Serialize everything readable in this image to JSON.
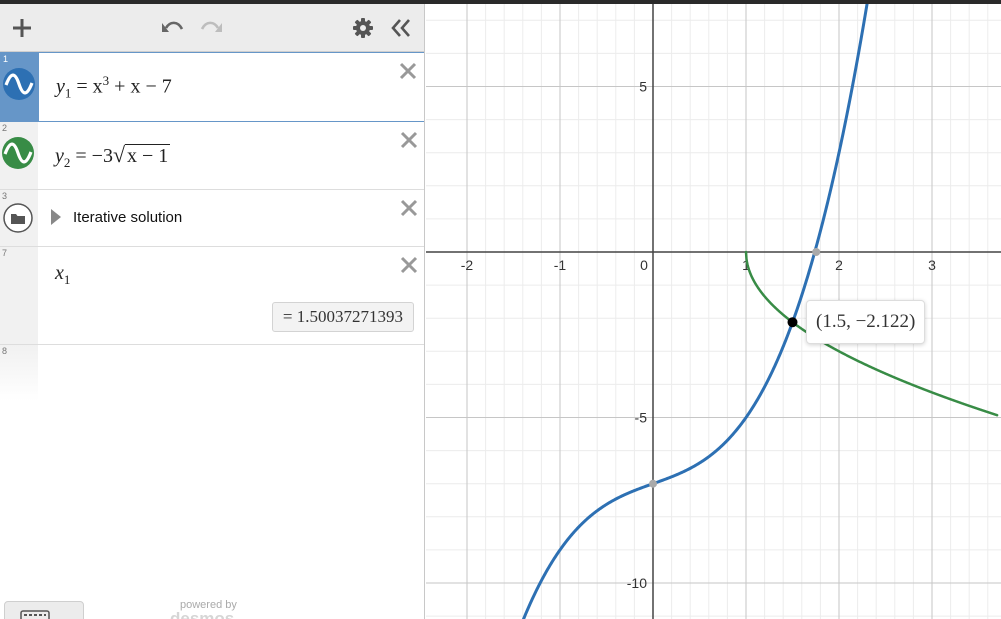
{
  "toolbar": {
    "add_icon": "plus-icon",
    "undo_icon": "undo-icon",
    "redo_icon": "redo-icon",
    "settings_icon": "gear-icon",
    "collapse_icon": "double-chevron-left-icon"
  },
  "expressions": [
    {
      "index": "1",
      "lhs": "y",
      "sub": "1",
      "rhs_prefix": "= x",
      "sup": "3",
      "rhs_suffix": " + x − 7",
      "color": "#2d70b3"
    },
    {
      "index": "2",
      "lhs": "y",
      "sub": "2",
      "rhs_prefix": "= −3",
      "radicand": "x − 1",
      "color": "#388c46"
    },
    {
      "index": "3",
      "folder_label": "Iterative solution"
    },
    {
      "index": "7",
      "lhs": "x",
      "sub": "1",
      "result": "= 1.50037271393"
    },
    {
      "index": "8"
    }
  ],
  "footer": {
    "powered_by": "powered by",
    "brand": "desmos"
  },
  "graph": {
    "x_ticks": [
      "-2",
      "-1",
      "0",
      "1",
      "2",
      "3"
    ],
    "y_ticks": [
      "5",
      "-5",
      "-10"
    ],
    "point_label": "(1.5, −2.122)",
    "colors": {
      "blue": "#2d70b3",
      "green": "#388c46",
      "grid": "#e6e6e6"
    }
  },
  "chart_data": {
    "type": "line",
    "xlim": [
      -2.03,
      3.7
    ],
    "ylim": [
      -11.0,
      7.5
    ],
    "series": [
      {
        "expression": "y1 = x^3 + x - 7",
        "color": "#2d70b3"
      },
      {
        "expression": "y2 = -3*sqrt(x - 1)",
        "color": "#388c46"
      }
    ],
    "points": [
      {
        "x": 1.5,
        "y": -2.122,
        "label": "(1.5, −2.122)"
      },
      {
        "x": 0,
        "y": -7
      },
      {
        "x": 1.7549,
        "y": 0
      }
    ],
    "grid": true
  }
}
